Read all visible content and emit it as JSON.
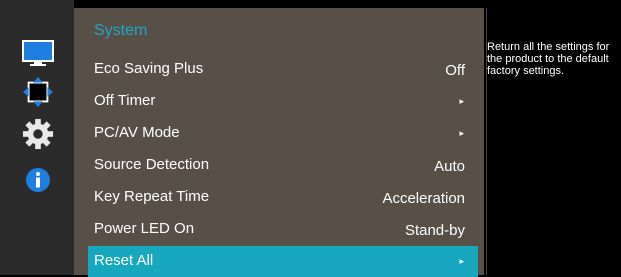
{
  "menu": {
    "title": "System",
    "items": [
      {
        "label": "Eco Saving Plus",
        "value": "Off"
      },
      {
        "label": "Off Timer",
        "arrow": "▸"
      },
      {
        "label": "PC/AV Mode",
        "arrow": "▸"
      },
      {
        "label": "Source Detection",
        "value": "Auto"
      },
      {
        "label": "Key Repeat Time",
        "value": "Acceleration"
      },
      {
        "label": "Power LED On",
        "value": "Stand-by"
      },
      {
        "label": "Reset All",
        "arrow": "▸",
        "selected": true
      }
    ]
  },
  "help": {
    "text": "Return all the settings for the product to the default factory settings."
  },
  "icons": [
    "monitor-icon",
    "move-arrows-icon",
    "gear-icon",
    "info-icon"
  ],
  "colors": {
    "accent": "#17a7bf",
    "title": "#1fa6c9",
    "panel": "#585047",
    "rail": "#2b2b2b"
  }
}
